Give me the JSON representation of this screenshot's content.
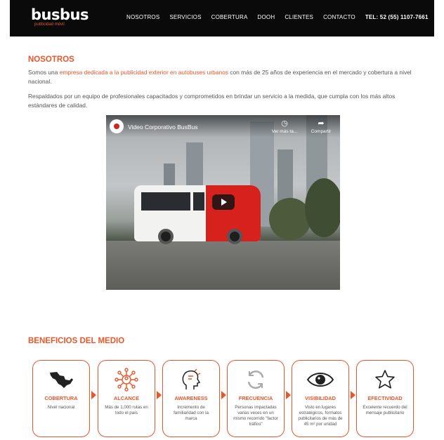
{
  "brand": {
    "name": "busbus",
    "tagline": "publicidad móvil",
    "accent": "#e8562a"
  },
  "nav": {
    "items": [
      "NOSOTROS",
      "SERVICIOS",
      "COBERTURA",
      "DOOH",
      "CLIENTES",
      "CONTACTO"
    ],
    "phone": "TEL: 52 (55) 1107-7661"
  },
  "about": {
    "title": "NOSOTROS",
    "p1_start": "Somos una ",
    "p1_highlight": "empresa dedicada a la publicidad exterior en autobuses urbanos",
    "p1_end": " con más de 25 años de experiencia en el mercado y cobertura a nivel nacional.",
    "p2": "Respaldados por un equipo de profesionales capacitados y comprometidos en brindar un servicio a la medida, que cumpla con los más altos estándares de calidad."
  },
  "video": {
    "title": "Video Corporativo BusBus",
    "watch_later": "Ver más ta...",
    "share": "Compartir"
  },
  "benefits": {
    "title": "BENEFICIOS DEL MEDIO",
    "cards": [
      {
        "icon": "mexico-map-icon",
        "title": "COBERTURA",
        "desc": "Nivel nacional"
      },
      {
        "icon": "network-people-icon",
        "title": "ALCANCE",
        "desc": "Más de 1,000 rutas en todo el país"
      },
      {
        "icon": "head-idea-icon",
        "title": "AWARENESS",
        "desc": "Incremento de familiaridad con la marca"
      },
      {
        "icon": "refresh-cycle-icon",
        "title": "FRECUENCIA",
        "desc": "Personas impactadas varias veces en un mismo recorrido \"factor tráfico\""
      },
      {
        "icon": "eye-icon",
        "title": "VISIBILIDAD",
        "desc": "Visto en lugares estratégicos, formatos publicitarios de más de 45 m² por unidad"
      },
      {
        "icon": "star-icon",
        "title": "EFECTIVIDAD",
        "desc": "Excelente recuerdo del mensaje publicitario"
      }
    ]
  }
}
